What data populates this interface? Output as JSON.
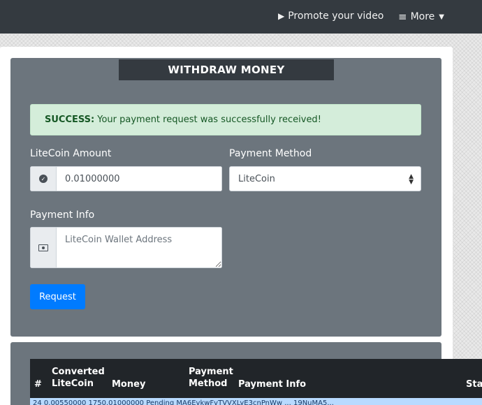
{
  "navbar": {
    "promote_label": "Promote your video",
    "more_label": "More"
  },
  "withdraw": {
    "title": "WITHDRAW MONEY",
    "alert_strong": "SUCCESS:",
    "alert_text": "Your payment request was successfully received!",
    "amount_label": "LiteCoin Amount",
    "amount_value": "0.01000000",
    "method_label": "Payment Method",
    "method_value": "LiteCoin",
    "info_label": "Payment Info",
    "info_placeholder": "LiteCoin Wallet Address",
    "request_button": "Request"
  },
  "history": {
    "columns": {
      "num": "#",
      "converted_line1": "Converted",
      "converted_line2": "LiteCoin",
      "money": "Money",
      "method_line1": "Payment",
      "method_line2": "Method",
      "info": "Payment Info",
      "status": "Sta"
    },
    "rows": [
      {
        "text": "24   0.00550000   1750.01000000   Pending   MA6EvkwFvTVVXLyE3cnPnWw   ... 19NuMA5..."
      }
    ]
  },
  "colors": {
    "navbar_bg": "#343a40",
    "panel_bg": "#6c757d",
    "success_bg": "#d4edda",
    "success_text": "#155724",
    "primary": "#007bff",
    "table_head_bg": "#212529",
    "row_highlight": "#b8daff"
  }
}
